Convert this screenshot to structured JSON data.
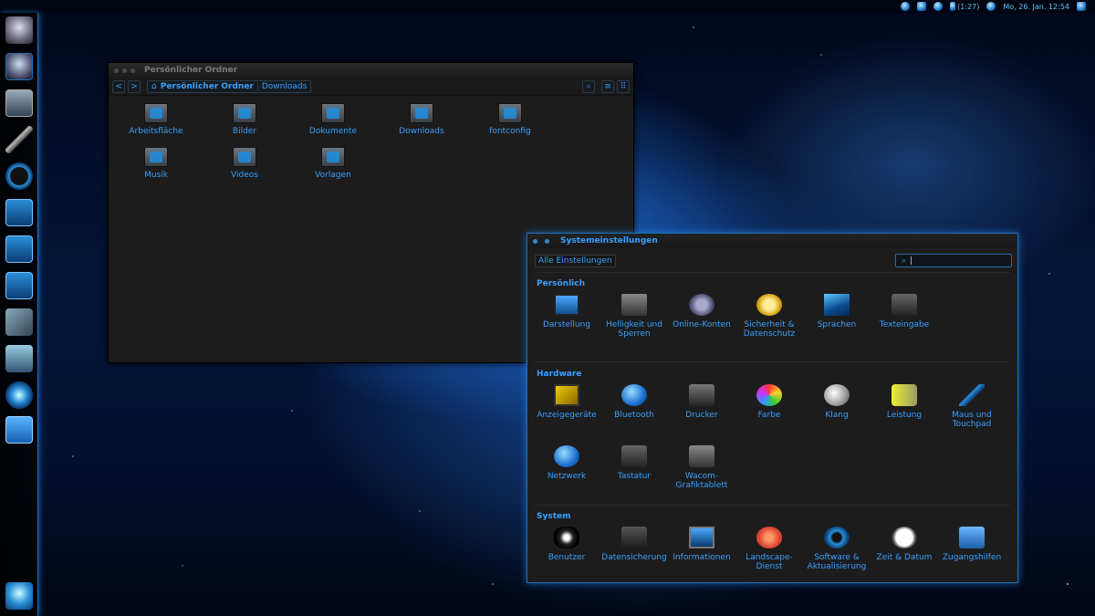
{
  "topbar": {
    "battery_time": "(1:27)",
    "datetime": "Mo, 26. Jan. 12:54"
  },
  "launcher": {
    "items": [
      "home-icon",
      "files-icon",
      "terminal-icon",
      "settings-tools-icon",
      "browser-icon",
      "writer-icon",
      "calc-icon",
      "impress-icon",
      "texmaker-icon",
      "installer-icon",
      "compiz-icon",
      "software-center-icon",
      "trash-icon"
    ]
  },
  "filemanager": {
    "title": "Persönlicher Ordner",
    "breadcrumb": {
      "current": "Persönlicher Ordner",
      "next": "Downloads"
    },
    "nav": {
      "back": "<",
      "forward": ">"
    },
    "files": [
      {
        "name": "Arbeitsfläche"
      },
      {
        "name": "Bilder"
      },
      {
        "name": "Dokumente"
      },
      {
        "name": "Downloads"
      },
      {
        "name": "fontconfig"
      },
      {
        "name": "Musik"
      },
      {
        "name": "Videos"
      },
      {
        "name": "Vorlagen"
      }
    ]
  },
  "settings": {
    "title": "Systemeinstellungen",
    "all_label": "Alle Einstellungen",
    "search_placeholder": "",
    "sections": [
      {
        "title": "Persönlich",
        "items": [
          {
            "line1": "Darstellung",
            "line2": ""
          },
          {
            "line1": "Helligkeit und",
            "line2": "Sperren"
          },
          {
            "line1": "Online-Konten",
            "line2": ""
          },
          {
            "line1": "Sicherheit &",
            "line2": "Datenschutz"
          },
          {
            "line1": "Sprachen",
            "line2": ""
          },
          {
            "line1": "Texteingabe",
            "line2": ""
          }
        ]
      },
      {
        "title": "Hardware",
        "items": [
          {
            "line1": "Anzeigegeräte",
            "line2": ""
          },
          {
            "line1": "Bluetooth",
            "line2": ""
          },
          {
            "line1": "Drucker",
            "line2": ""
          },
          {
            "line1": "Farbe",
            "line2": ""
          },
          {
            "line1": "Klang",
            "line2": ""
          },
          {
            "line1": "Leistung",
            "line2": ""
          },
          {
            "line1": "Maus und",
            "line2": "Touchpad"
          },
          {
            "line1": "Netzwerk",
            "line2": ""
          },
          {
            "line1": "Tastatur",
            "line2": ""
          },
          {
            "line1": "Wacom-",
            "line2": "Grafiktablett"
          }
        ]
      },
      {
        "title": "System",
        "items": [
          {
            "line1": "Benutzer",
            "line2": ""
          },
          {
            "line1": "Datensicherung",
            "line2": ""
          },
          {
            "line1": "Informationen",
            "line2": ""
          },
          {
            "line1": "Landscape-",
            "line2": "Dienst"
          },
          {
            "line1": "Software &",
            "line2": "Aktualisierung"
          },
          {
            "line1": "Zeit & Datum",
            "line2": ""
          },
          {
            "line1": "Zugangshilfen",
            "line2": ""
          }
        ]
      }
    ]
  },
  "colors": {
    "accent": "#3aa0ff",
    "window_bg": "#1c1c1c"
  }
}
